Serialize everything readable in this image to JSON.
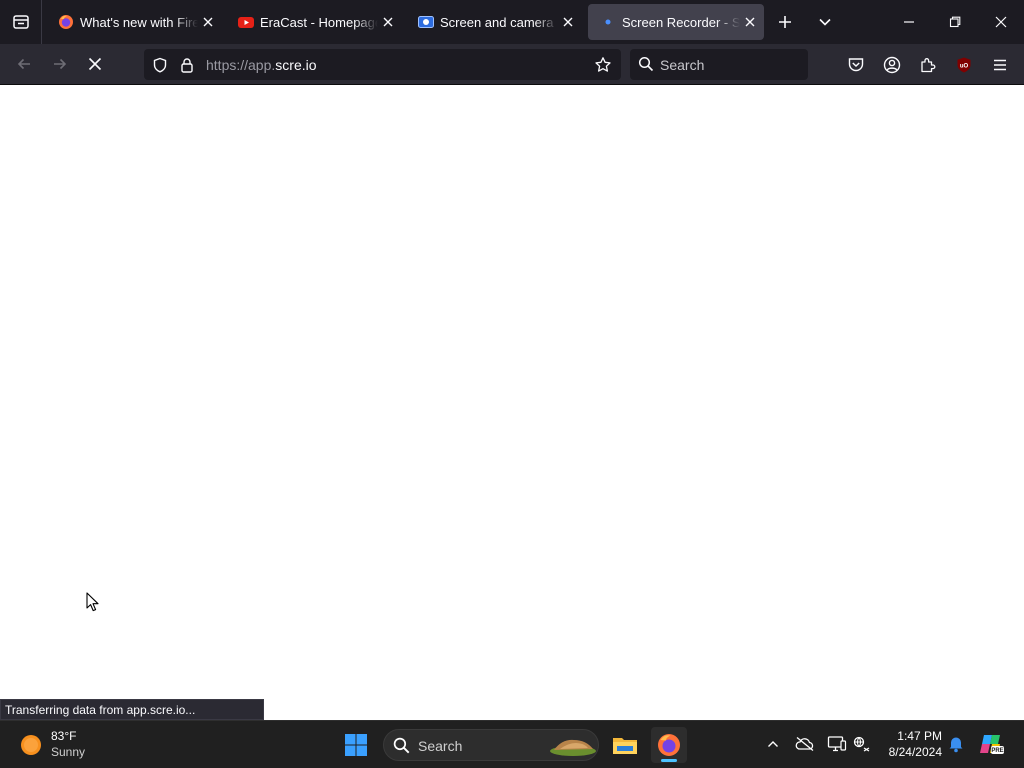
{
  "browser": {
    "tabs": [
      {
        "title": "What's new with Firefox",
        "favicon": "firefox-icon",
        "active": false
      },
      {
        "title": "EraCast - Homepage",
        "favicon": "youtube-icon",
        "active": false
      },
      {
        "title": "Screen and camera recorder",
        "favicon": "recorder-icon",
        "active": false
      },
      {
        "title": "Screen Recorder - Screen",
        "favicon": "loading-dot-icon",
        "active": true
      }
    ],
    "url": {
      "scheme": "https://app.",
      "host": "scre.io"
    },
    "search_placeholder": "Search",
    "status_text": "Transferring data from app.scre.io...",
    "loading": true
  },
  "taskbar": {
    "weather": {
      "temp": "83°F",
      "condition": "Sunny"
    },
    "search_placeholder": "Search",
    "clock": {
      "time": "1:47 PM",
      "date": "8/24/2024"
    }
  },
  "colors": {
    "tabbar_bg": "#1c1b22",
    "navbar_bg": "#2b2a33",
    "active_tab_bg": "#42414d",
    "taskbar_bg": "#202020",
    "accent": "#4cc2ff"
  }
}
